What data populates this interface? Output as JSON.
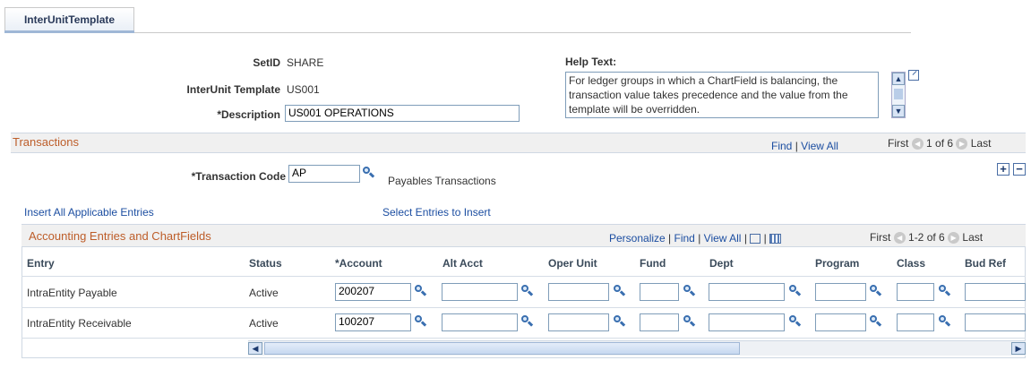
{
  "tab": {
    "label": "InterUnitTemplate"
  },
  "header": {
    "setid_label": "SetID",
    "setid_value": "SHARE",
    "template_label": "InterUnit Template",
    "template_value": "US001",
    "description_label": "*Description",
    "description_value": "US001 OPERATIONS",
    "help_label": "Help Text:",
    "help_text": "For ledger groups in which a ChartField is balancing, the transaction value takes precedence and the value from the template will be overridden."
  },
  "transactions": {
    "title": "Transactions",
    "find": "Find",
    "sep": "|",
    "view_all": "View All",
    "first": "First",
    "range": "1 of 6",
    "last": "Last",
    "code_label": "*Transaction Code",
    "code_value": "AP",
    "code_desc": "Payables Transactions"
  },
  "links": {
    "insert_all": "Insert All Applicable Entries",
    "select_entries": "Select Entries to Insert"
  },
  "grid": {
    "title": "Accounting Entries and ChartFields",
    "personalize": "Personalize",
    "find": "Find",
    "view_all": "View All",
    "sep": "|",
    "first": "First",
    "range": "1-2 of 6",
    "last": "Last",
    "columns": [
      "Entry",
      "Status",
      "*Account",
      "Alt Acct",
      "Oper Unit",
      "Fund",
      "Dept",
      "Program",
      "Class",
      "Bud Ref"
    ],
    "rows": [
      {
        "entry": "IntraEntity Payable",
        "status": "Active",
        "account": "200207"
      },
      {
        "entry": "IntraEntity Receivable",
        "status": "Active",
        "account": "100207"
      }
    ]
  },
  "icons": {
    "lookup": "magnifier-icon",
    "expand": "expand-window-icon",
    "add": "plus-icon",
    "delete": "minus-icon",
    "prev": "left-arrow-icon",
    "next": "right-arrow-icon",
    "download": "spreadsheet-icon"
  },
  "colors": {
    "link": "#1c4ea1",
    "section_title": "#bd5d29"
  }
}
